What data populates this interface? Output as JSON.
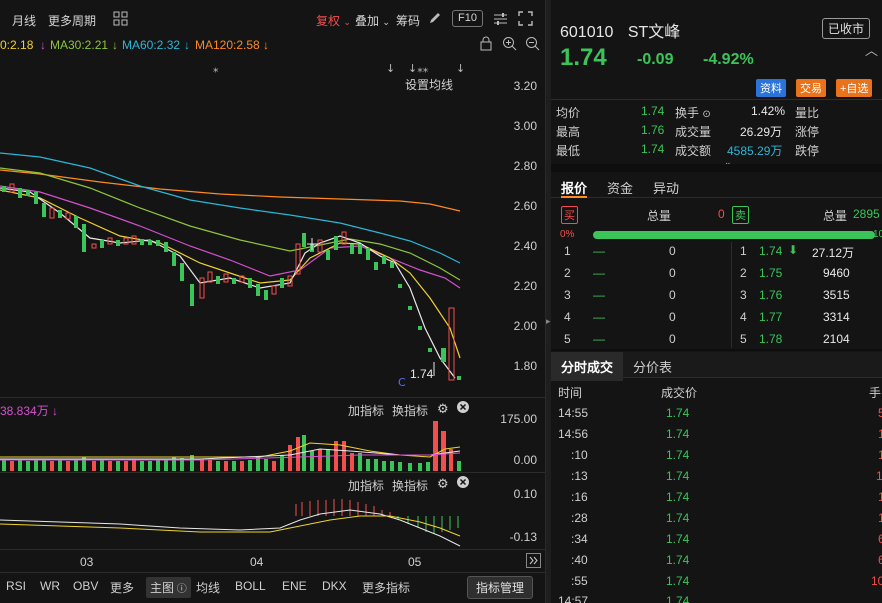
{
  "toolbar": {
    "period": "月线",
    "more_period": "更多周期",
    "fuquan": "复权",
    "overlay": "叠加",
    "chips": "筹码",
    "f10": "F10"
  },
  "ma": {
    "ma_prefix": "0:2.18",
    "ma30": "MA30:2.21",
    "ma60": "MA60:2.32",
    "ma120": "MA120:2.58",
    "setting": "设置均线"
  },
  "price_axis": [
    "3.20",
    "3.00",
    "2.80",
    "2.60",
    "2.40",
    "2.20",
    "2.00",
    "1.80"
  ],
  "last_price_label": "1.74",
  "vol_panel": {
    "value": "38.834万",
    "add_indicator": "加指标",
    "switch_indicator": "换指标",
    "axis": [
      "175.00",
      "0.00"
    ]
  },
  "macd_panel": {
    "add_indicator": "加指标",
    "switch_indicator": "换指标",
    "axis": [
      "0.10",
      "-0.13"
    ]
  },
  "time_axis": [
    "03",
    "04",
    "05"
  ],
  "bottom_tabs": [
    "RSI",
    "WR",
    "OBV",
    "更多",
    "主图",
    "均线",
    "BOLL",
    "ENE",
    "DKX",
    "更多指标"
  ],
  "indicator_manage": "指标管理",
  "stock": {
    "code": "601010",
    "name": "ST文峰",
    "status": "已收市",
    "price": "1.74",
    "change": "-0.09",
    "change_pct": "-4.92%",
    "tag_info": "资料",
    "tag_trade": "交易",
    "tag_watch": "+自选"
  },
  "stats": [
    {
      "label": "均价",
      "value": "1.74"
    },
    {
      "label": "最高",
      "value": "1.76"
    },
    {
      "label": "最低",
      "value": "1.74"
    }
  ],
  "stats2": [
    {
      "label": "换手",
      "value": "1.42%"
    },
    {
      "label": "成交量",
      "value": "26.29万"
    },
    {
      "label": "成交额",
      "value": "4585.29万"
    }
  ],
  "stats3": [
    "量比",
    "涨停",
    "跌停"
  ],
  "quote_tabs": [
    "报价",
    "资金",
    "异动"
  ],
  "order_book": {
    "buy_tag": "买",
    "sell_tag": "卖",
    "total_label": "总量",
    "buy_total": "0",
    "sell_total_label": "总量",
    "sell_total": "2895",
    "pct_left": "0%",
    "pct_right": "10",
    "buys": [
      {
        "n": "1",
        "p": "—",
        "v": "0"
      },
      {
        "n": "2",
        "p": "—",
        "v": "0"
      },
      {
        "n": "3",
        "p": "—",
        "v": "0"
      },
      {
        "n": "4",
        "p": "—",
        "v": "0"
      },
      {
        "n": "5",
        "p": "—",
        "v": "0"
      }
    ],
    "sells": [
      {
        "n": "1",
        "p": "1.74",
        "v": "27.12万"
      },
      {
        "n": "2",
        "p": "1.75",
        "v": "9460"
      },
      {
        "n": "3",
        "p": "1.76",
        "v": "3515"
      },
      {
        "n": "4",
        "p": "1.77",
        "v": "3314"
      },
      {
        "n": "5",
        "p": "1.78",
        "v": "2104"
      }
    ]
  },
  "trade_tabs": [
    "分时成交",
    "分价表"
  ],
  "trades_header": {
    "time": "时间",
    "price": "成交价",
    "hand": "手"
  },
  "trades": [
    {
      "t": "14:55",
      "p": "1.74",
      "v": "5"
    },
    {
      "t": "14:56",
      "p": "1.74",
      "v": "1"
    },
    {
      "t": ":10",
      "p": "1.74",
      "v": "1"
    },
    {
      "t": ":13",
      "p": "1.74",
      "v": "1"
    },
    {
      "t": ":16",
      "p": "1.74",
      "v": "1"
    },
    {
      "t": ":28",
      "p": "1.74",
      "v": "1"
    },
    {
      "t": ":34",
      "p": "1.74",
      "v": "6"
    },
    {
      "t": ":40",
      "p": "1.74",
      "v": "6"
    },
    {
      "t": ":55",
      "p": "1.74",
      "v": "10"
    },
    {
      "t": "14:57",
      "p": "1.74",
      "v": ""
    }
  ],
  "colors": {
    "up": "#f24e4e",
    "down": "#3bc45a",
    "accent": "#ff8a1f",
    "ma_white": "#e8e8e8",
    "ma_yellow": "#f0d22c",
    "ma_pink": "#d64fd0",
    "ma_green": "#8fc43b",
    "ma_cyan": "#2bb6d6",
    "ma_orange": "#ff8a1f"
  }
}
